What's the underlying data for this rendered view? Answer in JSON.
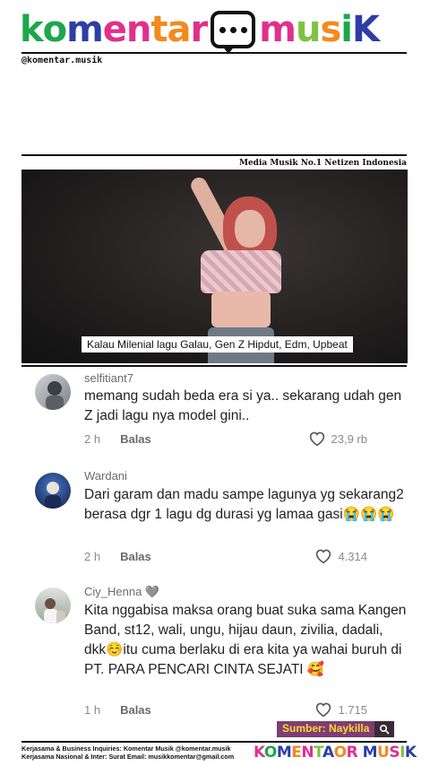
{
  "header": {
    "logo_letters": [
      {
        "ch": "k",
        "color": "#1ca84a"
      },
      {
        "ch": "o",
        "color": "#1ca84a"
      },
      {
        "ch": "m",
        "color": "#2d3ea6"
      },
      {
        "ch": "e",
        "color": "#e0308c"
      },
      {
        "ch": "n",
        "color": "#e0308c"
      },
      {
        "ch": "t",
        "color": "#f28a1e"
      },
      {
        "ch": "a",
        "color": "#f28a1e"
      },
      {
        "ch": "r",
        "color": "#e0308c"
      }
    ],
    "logo_letters_2": [
      {
        "ch": "m",
        "color": "#e0308c"
      },
      {
        "ch": "u",
        "color": "#7fc242"
      },
      {
        "ch": "s",
        "color": "#f28a1e"
      },
      {
        "ch": "i",
        "color": "#1ca84a"
      },
      {
        "ch": "K",
        "color": "#2d3ea6"
      }
    ],
    "handle": "@komentar.musik",
    "tagline": "Media Musik No.1 Netizen Indonesia"
  },
  "video": {
    "subtitle": "Kalau Milenial lagu Galau, Gen Z Hipdut, Edm, Upbeat"
  },
  "comments": [
    {
      "username": "selfitiant7",
      "text": "memang sudah beda era si ya.. sekarang udah gen Z jadi lagu nya model gini..",
      "time": "2 h",
      "reply": "Balas",
      "likes": "23,9 rb"
    },
    {
      "username": "Wardani",
      "text": "Dari garam dan madu sampe lagunya yg sekarang2 berasa dgr 1 lagu dg durasi yg lamaa gasi😭😭😭",
      "time": "2 h",
      "reply": "Balas",
      "likes": "4.314"
    },
    {
      "username": "Ciy_Henna 🩶",
      "text": "Kita nggabisa maksa orang buat suka sama Kangen Band, st12, wali, ungu, hijau daun, zivilia, dadali, dkk☺️itu cuma berlaku di era kita ya wahai buruh di PT. PARA PENCARI CINTA SEJATI 🥰",
      "time": "1 h",
      "reply": "Balas",
      "likes": "1.715"
    }
  ],
  "source": {
    "label": "Sumber: Naykilla"
  },
  "footer": {
    "line1": "Kerjasama & Business Inquiries: Komentar Musik @komentar.musik",
    "line2": "Kerjasama Nasional & Inter: Surat Email: musikkomentar@gmail.com",
    "logo": "KOMENTAOR MUSIK"
  }
}
